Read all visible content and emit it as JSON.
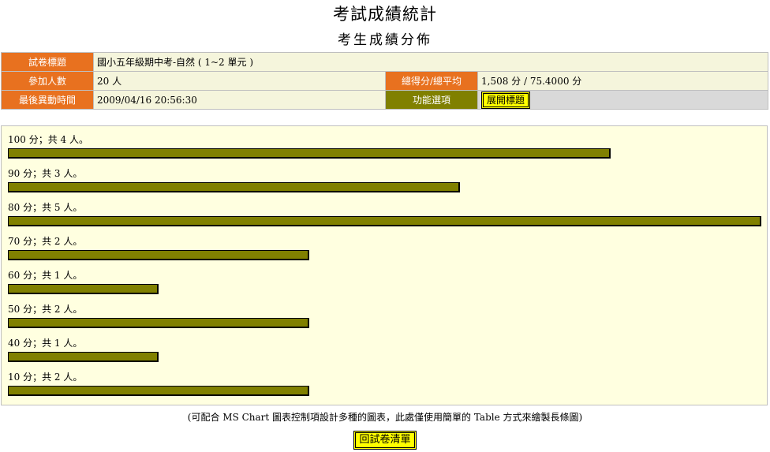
{
  "header": {
    "title": "考試成績統計",
    "subtitle": "考生成績分佈"
  },
  "info": {
    "exam_title_label": "試卷標題",
    "exam_title_value": "國小五年級期中考-自然 ( 1~2 單元 )",
    "participants_label": "參加人數",
    "participants_value": "20 人",
    "total_avg_label": "總得分/總平均",
    "total_avg_value": "1,508 分 /  75.4000 分",
    "last_modified_label": "最後異動時間",
    "last_modified_value": "2009/04/16 20:56:30",
    "functions_label": "功能選項",
    "expand_button": "展開標題"
  },
  "chart_data": {
    "type": "bar",
    "orientation": "horizontal",
    "categories": [
      "100 分",
      "90 分",
      "80 分",
      "70 分",
      "60 分",
      "50 分",
      "40 分",
      "10 分"
    ],
    "values": [
      4,
      3,
      5,
      2,
      1,
      2,
      1,
      2
    ],
    "labels": [
      "100 分；共 4 人。",
      "90 分；共 3 人。",
      "80 分；共 5 人。",
      "70 分；共 2 人。",
      "60 分；共 1 人。",
      "50 分；共 2 人。",
      "40 分；共 1 人。",
      "10 分；共 2 人。"
    ],
    "xlim": [
      0,
      5
    ],
    "bar_color": "#808000"
  },
  "footer": {
    "note": "(可配合 MS Chart 圖表控制項設計多種的圖表，此處僅使用簡單的 Table 方式來繪製長條圖)",
    "back_button": "回試卷清單"
  }
}
